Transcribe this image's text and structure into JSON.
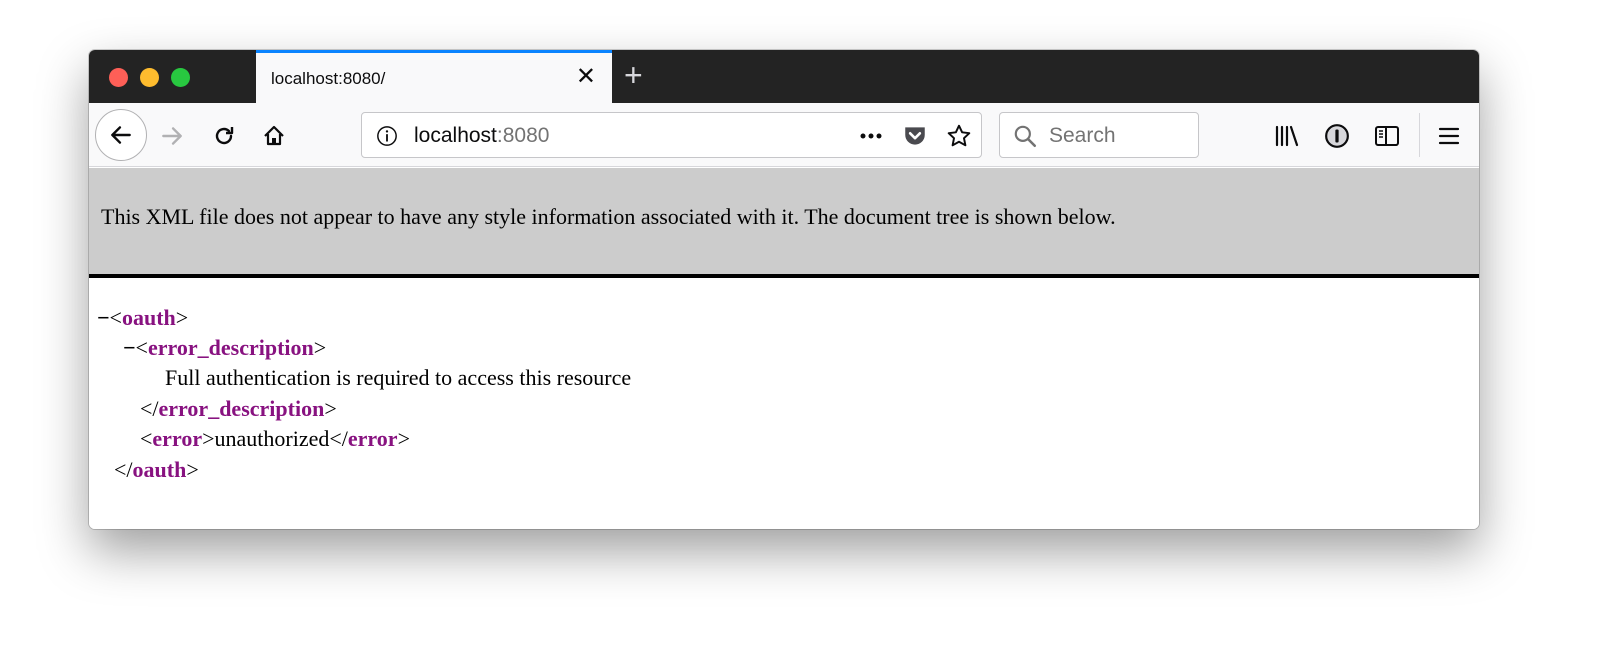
{
  "window": {
    "tab": {
      "title": "localhost:8080/",
      "close_glyph": "✕"
    },
    "new_tab_glyph": "+",
    "url": {
      "host": "localhost",
      "port": ":8080"
    },
    "search": {
      "placeholder": "Search"
    },
    "accent_color": "#0a84ff"
  },
  "banner": {
    "text": "This XML file does not appear to have any style information associated with it. The document tree is shown below."
  },
  "xml": {
    "collapse_glyph": "−",
    "root_tag": "oauth",
    "desc_tag": "error_description",
    "desc_text": "Full authentication is required to access this resource",
    "error_tag": "error",
    "error_text": "unauthorized",
    "tag_color": "#881280"
  }
}
